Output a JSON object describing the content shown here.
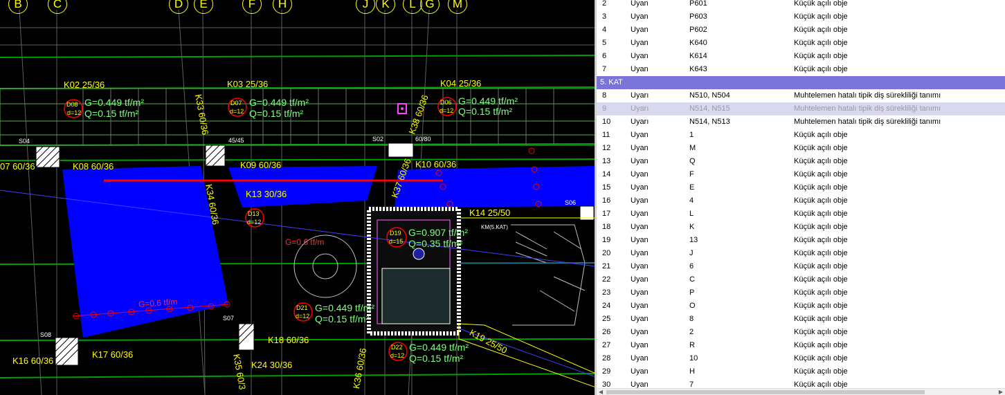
{
  "cad": {
    "axes": [
      "B",
      "C",
      "D",
      "E",
      "F",
      "H",
      "J",
      "K",
      "L",
      "G",
      "M"
    ],
    "beams": {
      "k02": "K02 25/36",
      "k03": "K03 25/36",
      "k04": "K04 25/36",
      "k07": "07 60/36",
      "k08": "K08 60/36",
      "k09": "K09 60/36",
      "k10": "K10 60/36",
      "k13": "K13 30/36",
      "k14": "K14 25/50",
      "k16": "K16 60/36",
      "k17": "K17 60/36",
      "k18": "K18 60/36",
      "k24": "K24 30/36",
      "k33": "K33 60/36",
      "k34": "K34 60/36",
      "k35": "K35 60/3",
      "k37": "K37 60/36",
      "k38": "K38 60/36",
      "k19": "K19 25/50",
      "k36": "K36 60/36"
    },
    "slabs": {
      "d08": {
        "id": "D08",
        "d": "d=12"
      },
      "d07": {
        "id": "D07",
        "d": "d=12"
      },
      "d06": {
        "id": "D06",
        "d": "d=12"
      },
      "d13": {
        "id": "D13",
        "d": "d=12"
      },
      "d19": {
        "id": "D19",
        "d": "d=15"
      },
      "d21": {
        "id": "D21",
        "d": "d=12"
      },
      "d22": {
        "id": "D22",
        "d": "d=12"
      }
    },
    "loads": {
      "g449": "G=0.449 tf/m²",
      "q015": "Q=0.15 tf/m²",
      "g907": "G=0.907 tf/m²",
      "q035": "Q=0.35 tf/m²",
      "g06": "G=0.6 tf/m"
    },
    "columns": {
      "s06": "S06",
      "s07": "S07",
      "s08": "S08",
      "s02": "S02",
      "s04": "S04"
    },
    "misc": {
      "km": "KM(5.KAT)",
      "dim": "45/45",
      "dim2": "60/80"
    }
  },
  "panel": {
    "rows_top": [
      {
        "no": "2",
        "status": "Uyan",
        "object": "P601",
        "message": "Küçük açılı obje"
      },
      {
        "no": "3",
        "status": "Uyan",
        "object": "P603",
        "message": "Küçük açılı obje"
      },
      {
        "no": "4",
        "status": "Uyan",
        "object": "P602",
        "message": "Küçük açılı obje"
      },
      {
        "no": "5",
        "status": "Uyan",
        "object": "K640",
        "message": "Küçük açılı obje"
      },
      {
        "no": "6",
        "status": "Uyan",
        "object": "K614",
        "message": "Küçük açılı obje"
      },
      {
        "no": "7",
        "status": "Uyan",
        "object": "K643",
        "message": "Küçük açılı obje"
      }
    ],
    "group_label": "5. KAT",
    "rows_bottom": [
      {
        "no": "8",
        "status": "Uyarı",
        "object": "N510, N504",
        "message": "Muhtelemen hatalı tipik diş sürekliliği tanımı"
      },
      {
        "no": "9",
        "status": "Uyarı",
        "object": "N514, N515",
        "message": "Muhtelemen hatalı tipik diş sürekliliği tanımı"
      },
      {
        "no": "10",
        "status": "Uyarı",
        "object": "N514, N513",
        "message": "Muhtelemen hatalı tipik diş sürekliliği tanımı"
      },
      {
        "no": "11",
        "status": "Uyan",
        "object": "1",
        "message": "Küçük açılı obje"
      },
      {
        "no": "12",
        "status": "Uyan",
        "object": "M",
        "message": "Küçük açılı obje"
      },
      {
        "no": "13",
        "status": "Uyan",
        "object": "Q",
        "message": "Küçük açılı obje"
      },
      {
        "no": "14",
        "status": "Uyan",
        "object": "F",
        "message": "Küçük açılı obje"
      },
      {
        "no": "15",
        "status": "Uyan",
        "object": "E",
        "message": "Küçük açılı obje"
      },
      {
        "no": "16",
        "status": "Uyan",
        "object": "4",
        "message": "Küçük açılı obje"
      },
      {
        "no": "17",
        "status": "Uyan",
        "object": "L",
        "message": "Küçük açılı obje"
      },
      {
        "no": "18",
        "status": "Uyan",
        "object": "K",
        "message": "Küçük açılı obje"
      },
      {
        "no": "19",
        "status": "Uyan",
        "object": "13",
        "message": "Küçük açılı obje"
      },
      {
        "no": "20",
        "status": "Uyan",
        "object": "J",
        "message": "Küçük açılı obje"
      },
      {
        "no": "21",
        "status": "Uyan",
        "object": "6",
        "message": "Küçük açılı obje"
      },
      {
        "no": "22",
        "status": "Uyan",
        "object": "C",
        "message": "Küçük açılı obje"
      },
      {
        "no": "23",
        "status": "Uyan",
        "object": "P",
        "message": "Küçük açılı obje"
      },
      {
        "no": "24",
        "status": "Uyan",
        "object": "O",
        "message": "Küçük açılı obje"
      },
      {
        "no": "25",
        "status": "Uyan",
        "object": "8",
        "message": "Küçük açılı obje"
      },
      {
        "no": "26",
        "status": "Uyan",
        "object": "2",
        "message": "Küçük açılı obje"
      },
      {
        "no": "27",
        "status": "Uyan",
        "object": "R",
        "message": "Küçük açılı obje"
      },
      {
        "no": "28",
        "status": "Uyan",
        "object": "10",
        "message": "Küçük açılı obje"
      },
      {
        "no": "29",
        "status": "Uyan",
        "object": "H",
        "message": "Küçük açılı obje"
      },
      {
        "no": "30",
        "status": "Uyan",
        "object": "7",
        "message": "Küçük açılı obje"
      }
    ],
    "selected_no": "9",
    "group_color": "#7b74d8",
    "selected_color": "#d8d8ee"
  },
  "colors": {
    "slab_blue": "#0000ff",
    "beam_green": "#00c000",
    "text_yellow": "#ffff00",
    "text_green": "#80ff80",
    "marker_red": "#ff0000"
  }
}
